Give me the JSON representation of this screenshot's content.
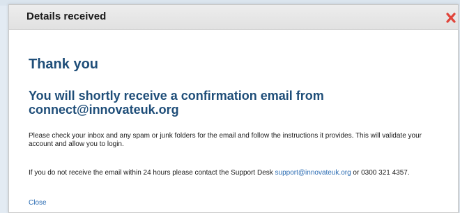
{
  "dialog": {
    "title": "Details received",
    "close_icon": "close-x-icon",
    "heading": "Thank you",
    "subheading": "You will shortly receive a confirmation email from connect@innovateuk.org",
    "paragraph1": "Please check your inbox and any spam or junk folders for the email and follow the instructions it provides. This will validate your account and allow you to login.",
    "paragraph2_prefix": "If you do not receive the email within 24 hours please contact the Support Desk ",
    "support_email": "support@innovateuk.org",
    "paragraph2_suffix": " or 0300 321 4357.",
    "close_link_label": "Close"
  },
  "colors": {
    "heading": "#1f4e79",
    "link": "#2b6cb3",
    "close_icon": "#e0443a"
  }
}
